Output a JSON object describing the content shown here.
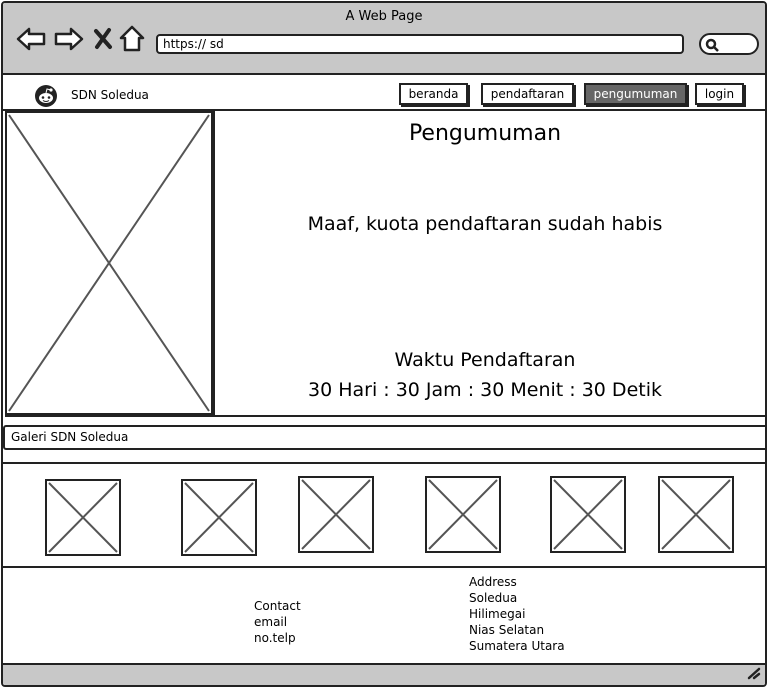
{
  "browser": {
    "window_title": "A Web Page",
    "url": "https:// sd",
    "icons": [
      "back-arrow-icon",
      "forward-arrow-icon",
      "close-x-icon",
      "home-icon",
      "search-icon",
      "resize-grip-icon"
    ]
  },
  "header": {
    "site_name": "SDN Soledua",
    "logo_icon": "reddit-alien-icon",
    "menu": [
      {
        "label": "beranda",
        "active": false
      },
      {
        "label": "pendaftaran",
        "active": false
      },
      {
        "label": "pengumuman",
        "active": true
      },
      {
        "label": "login",
        "active": false
      }
    ]
  },
  "hero": {
    "title": "Pengumuman",
    "message": "Maaf, kuota pendaftaran sudah habis",
    "time_label": "Waktu Pendaftaran",
    "countdown": "30 Hari : 30 Jam : 30 Menit : 30 Detik"
  },
  "gallery": {
    "title": "Galeri SDN Soledua",
    "image_count": 6
  },
  "footer": {
    "contact": [
      "Contact",
      "email",
      "no.telp"
    ],
    "address": [
      "Address",
      "Soledua",
      "Hilimegai",
      "Nias Selatan",
      "Sumatera Utara"
    ]
  },
  "colors": {
    "chrome": "#c8c8c8",
    "active_menu": "#666666",
    "outline": "#222222"
  }
}
